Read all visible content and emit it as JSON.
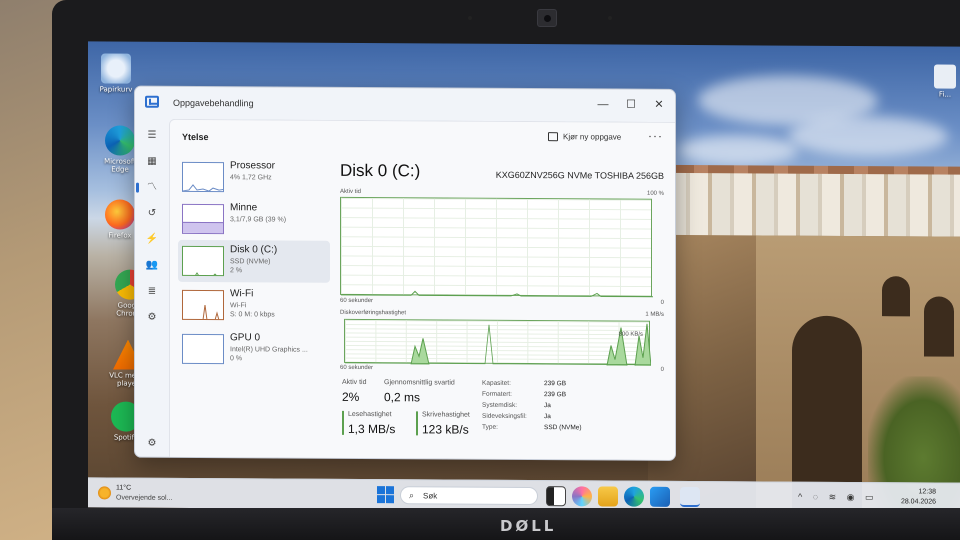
{
  "screen": {
    "desktop_icons": [
      "Papirkurv",
      "Microsoft Edge",
      "Firefox",
      "Google Chrome",
      "VLC media player",
      "Spotify",
      "Fi..."
    ]
  },
  "window": {
    "title": "Oppgavebehandling",
    "controls": {
      "minimize": "—",
      "maximize": "☐",
      "close": "✕"
    }
  },
  "rail_icons": [
    "menu-icon",
    "processes-icon",
    "performance-icon",
    "app-history-icon",
    "startup-icon",
    "users-icon",
    "details-icon",
    "services-icon",
    "settings-icon"
  ],
  "header": {
    "section": "Ytelse",
    "new_task": "Kjør ny oppgave",
    "more": "···"
  },
  "sidebar": {
    "items": [
      {
        "name": "Prosessor",
        "sub": "4%  1,72 GHz",
        "val": "",
        "selected": false
      },
      {
        "name": "Minne",
        "sub": "3,1/7,9 GB (39 %)",
        "val": "",
        "selected": false
      },
      {
        "name": "Disk 0 (C:)",
        "sub": "SSD (NVMe)",
        "val": "2 %",
        "selected": true
      },
      {
        "name": "Wi-Fi",
        "sub": "Wi-Fi",
        "val": "S: 0  M: 0 kbps",
        "selected": false
      },
      {
        "name": "GPU 0",
        "sub": "Intel(R) UHD Graphics ...",
        "val": "0 %",
        "selected": false
      }
    ]
  },
  "perf": {
    "title": "Disk 0 (C:)",
    "model": "KXG60ZNV256G NVMe TOSHIBA 256GB",
    "graph1": {
      "label": "Aktiv tid",
      "max": "100 %",
      "time": "60 sekunder",
      "zero": "0"
    },
    "graph2": {
      "label": "Diskoverføringshastighet",
      "max": "1 MB/s",
      "mark": "800 KB/s",
      "time": "60 sekunder",
      "zero": "0"
    },
    "stats": {
      "active_label": "Aktiv tid",
      "active_value": "2%",
      "resp_label": "Gjennomsnittlig svartid",
      "resp_value": "0,2 ms",
      "read_label": "Lesehastighet",
      "read_value": "1,3 MB/s",
      "write_label": "Skrivehastighet",
      "write_value": "123 kB/s"
    },
    "props": [
      {
        "k": "Kapasitet:",
        "v": "239 GB"
      },
      {
        "k": "Formatert:",
        "v": "239 GB"
      },
      {
        "k": "Systemdisk:",
        "v": "Ja"
      },
      {
        "k": "Sideveksingsfil:",
        "v": "Ja"
      },
      {
        "k": "Type:",
        "v": "SSD (NVMe)"
      }
    ]
  },
  "taskbar": {
    "temp": "11°C",
    "weather": "Overvejende sol...",
    "search_placeholder": "Søk",
    "time": "12:38",
    "date": "28.04.2026"
  },
  "bezel": {
    "brand": "DØLL"
  },
  "colors": {
    "accent": "#2d6fcf",
    "disk_green": "#5ca04f",
    "window_bg": "#f1f4f9"
  }
}
